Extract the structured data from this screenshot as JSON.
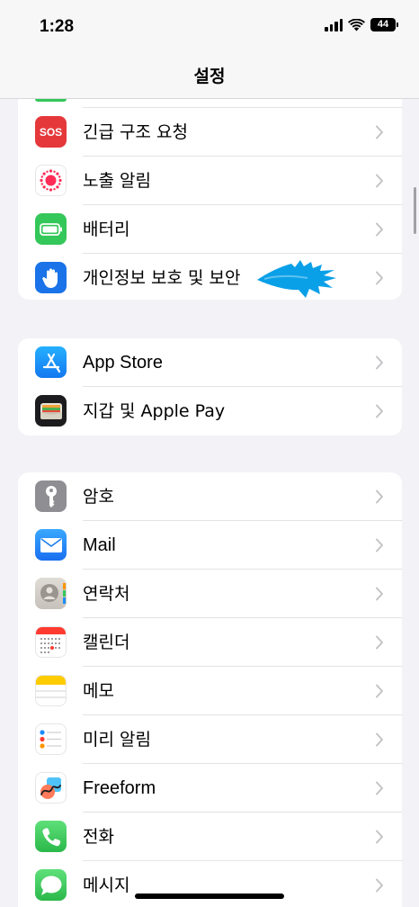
{
  "status_bar": {
    "time": "1:28",
    "battery": "44"
  },
  "nav": {
    "title": "설정"
  },
  "group1": {
    "items": [
      {
        "label": "긴급 구조 요청",
        "icon": "sos-icon",
        "icon_text": "SOS",
        "color": "#e5383b"
      },
      {
        "label": "노출 알림",
        "icon": "exposure-notification-icon",
        "color": "#ffffff"
      },
      {
        "label": "배터리",
        "icon": "battery-icon",
        "color": "#34c759"
      },
      {
        "label": "개인정보 보호 및 보안",
        "icon": "hand-icon",
        "color": "#1a73e8"
      }
    ]
  },
  "group2": {
    "items": [
      {
        "label": "App Store",
        "icon": "app-store-icon",
        "color": "#1a8cff"
      },
      {
        "label": "지갑 및 Apple Pay",
        "icon": "wallet-icon",
        "color": "#1c1c1e"
      }
    ]
  },
  "group3": {
    "items": [
      {
        "label": "암호",
        "icon": "key-icon",
        "color": "#8e8e93"
      },
      {
        "label": "Mail",
        "icon": "mail-icon",
        "color": "#1e8cf0"
      },
      {
        "label": "연락처",
        "icon": "contacts-icon",
        "color": "#cfcac3"
      },
      {
        "label": "캘린더",
        "icon": "calendar-icon",
        "color": "#ffffff"
      },
      {
        "label": "메모",
        "icon": "notes-icon",
        "color": "#ffffff"
      },
      {
        "label": "미리 알림",
        "icon": "reminders-icon",
        "color": "#ffffff"
      },
      {
        "label": "Freeform",
        "icon": "freeform-icon",
        "color": "#ffffff"
      },
      {
        "label": "전화",
        "icon": "phone-icon",
        "color": "#34c759"
      },
      {
        "label": "메시지",
        "icon": "messages-icon",
        "color": "#34c759"
      }
    ]
  },
  "annotation": {
    "arrow_color": "#0aa0e8"
  }
}
